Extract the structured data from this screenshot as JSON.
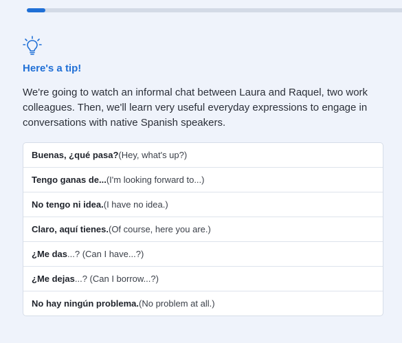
{
  "progress": {
    "value_percent": 5
  },
  "tip": {
    "icon": "lightbulb-icon",
    "title": "Here's a tip!",
    "body": "We're going to watch an informal chat between Laura and Raquel, two work colleagues. Then, we'll learn very useful everyday expressions to engage in conversations with native Spanish speakers."
  },
  "phrases": [
    {
      "spanish": "Buenas, ¿qué pasa?",
      "rest": " (Hey, what's up?)"
    },
    {
      "spanish": "Tengo ganas de...",
      "rest": " (I'm looking forward to...)"
    },
    {
      "spanish": "No tengo ni idea.",
      "rest": " (I have no idea.)"
    },
    {
      "spanish": "Claro, aquí tienes.",
      "rest": " (Of course, here you are.)"
    },
    {
      "spanish": "¿Me das",
      "rest": "...? (Can I have...?)"
    },
    {
      "spanish": "¿Me dejas",
      "rest": "...? (Can I borrow...?)"
    },
    {
      "spanish": "No hay ningún problema.",
      "rest": " (No problem at all.)"
    }
  ],
  "colors": {
    "accent": "#1f6fd6",
    "background": "#eff3fb",
    "text": "#2b2f38"
  }
}
